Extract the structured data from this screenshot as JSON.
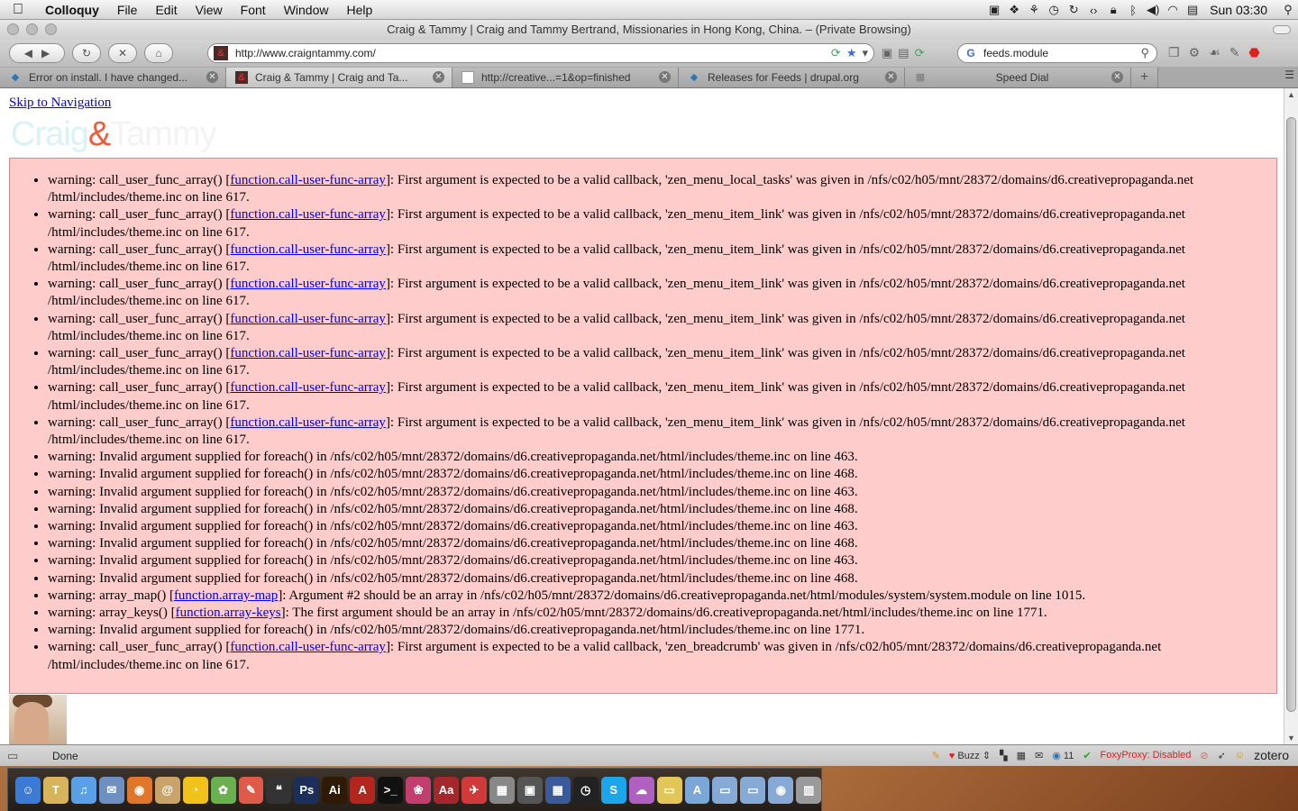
{
  "menubar": {
    "app_name": "Colloquy",
    "menus": [
      "File",
      "Edit",
      "View",
      "Font",
      "Window",
      "Help"
    ],
    "clock": "Sun 03:30",
    "status_icons": [
      "screen-icon",
      "dropbox-icon",
      "timemachine-alt-icon",
      "timemachine-icon",
      "sync-icon",
      "code-icon",
      "lock-icon",
      "bluetooth-icon",
      "volume-icon",
      "wifi-icon",
      "flag-us-icon"
    ]
  },
  "window": {
    "title": "Craig & Tammy | Craig and Tammy Bertrand, Missionaries in Hong Kong, China. – (Private Browsing)"
  },
  "navbar": {
    "url": "http://www.craigntammy.com/",
    "search_value": "feeds.module",
    "favicon_text": "&"
  },
  "tabs": [
    {
      "label": "Error on install. I have changed...",
      "icon": "drupal-icon",
      "active": false
    },
    {
      "label": "Craig & Tammy | Craig and Ta...",
      "icon": "site-favicon-icon",
      "active": true
    },
    {
      "label": "http://creative...=1&op=finished",
      "icon": "page-icon",
      "active": false
    },
    {
      "label": "Releases for Feeds | drupal.org",
      "icon": "drupal-icon",
      "active": false
    },
    {
      "label": "Speed Dial",
      "icon": "grid-icon",
      "active": false
    }
  ],
  "page": {
    "skip_link": "Skip to Navigation",
    "logo": {
      "part1": "Craig",
      "amp": "&",
      "part2": "Tammy"
    },
    "messages": [
      {
        "pre": "warning: call_user_func_array() [",
        "link": "function.call-user-func-array",
        "post": "]: First argument is expected to be a valid callback, 'zen_menu_local_tasks' was given in /nfs/c02/h05/mnt/28372/domains/d6.creativepropaganda.net /html/includes/theme.inc on line 617."
      },
      {
        "pre": "warning: call_user_func_array() [",
        "link": "function.call-user-func-array",
        "post": "]: First argument is expected to be a valid callback, 'zen_menu_item_link' was given in /nfs/c02/h05/mnt/28372/domains/d6.creativepropaganda.net /html/includes/theme.inc on line 617."
      },
      {
        "pre": "warning: call_user_func_array() [",
        "link": "function.call-user-func-array",
        "post": "]: First argument is expected to be a valid callback, 'zen_menu_item_link' was given in /nfs/c02/h05/mnt/28372/domains/d6.creativepropaganda.net /html/includes/theme.inc on line 617."
      },
      {
        "pre": "warning: call_user_func_array() [",
        "link": "function.call-user-func-array",
        "post": "]: First argument is expected to be a valid callback, 'zen_menu_item_link' was given in /nfs/c02/h05/mnt/28372/domains/d6.creativepropaganda.net /html/includes/theme.inc on line 617."
      },
      {
        "pre": "warning: call_user_func_array() [",
        "link": "function.call-user-func-array",
        "post": "]: First argument is expected to be a valid callback, 'zen_menu_item_link' was given in /nfs/c02/h05/mnt/28372/domains/d6.creativepropaganda.net /html/includes/theme.inc on line 617."
      },
      {
        "pre": "warning: call_user_func_array() [",
        "link": "function.call-user-func-array",
        "post": "]: First argument is expected to be a valid callback, 'zen_menu_item_link' was given in /nfs/c02/h05/mnt/28372/domains/d6.creativepropaganda.net /html/includes/theme.inc on line 617."
      },
      {
        "pre": "warning: call_user_func_array() [",
        "link": "function.call-user-func-array",
        "post": "]: First argument is expected to be a valid callback, 'zen_menu_item_link' was given in /nfs/c02/h05/mnt/28372/domains/d6.creativepropaganda.net /html/includes/theme.inc on line 617."
      },
      {
        "pre": "warning: call_user_func_array() [",
        "link": "function.call-user-func-array",
        "post": "]: First argument is expected to be a valid callback, 'zen_menu_item_link' was given in /nfs/c02/h05/mnt/28372/domains/d6.creativepropaganda.net /html/includes/theme.inc on line 617."
      },
      {
        "pre": "warning: Invalid argument supplied for foreach() in /nfs/c02/h05/mnt/28372/domains/d6.creativepropaganda.net/html/includes/theme.inc on line 463.",
        "link": "",
        "post": ""
      },
      {
        "pre": "warning: Invalid argument supplied for foreach() in /nfs/c02/h05/mnt/28372/domains/d6.creativepropaganda.net/html/includes/theme.inc on line 468.",
        "link": "",
        "post": ""
      },
      {
        "pre": "warning: Invalid argument supplied for foreach() in /nfs/c02/h05/mnt/28372/domains/d6.creativepropaganda.net/html/includes/theme.inc on line 463.",
        "link": "",
        "post": ""
      },
      {
        "pre": "warning: Invalid argument supplied for foreach() in /nfs/c02/h05/mnt/28372/domains/d6.creativepropaganda.net/html/includes/theme.inc on line 468.",
        "link": "",
        "post": ""
      },
      {
        "pre": "warning: Invalid argument supplied for foreach() in /nfs/c02/h05/mnt/28372/domains/d6.creativepropaganda.net/html/includes/theme.inc on line 463.",
        "link": "",
        "post": ""
      },
      {
        "pre": "warning: Invalid argument supplied for foreach() in /nfs/c02/h05/mnt/28372/domains/d6.creativepropaganda.net/html/includes/theme.inc on line 468.",
        "link": "",
        "post": ""
      },
      {
        "pre": "warning: Invalid argument supplied for foreach() in /nfs/c02/h05/mnt/28372/domains/d6.creativepropaganda.net/html/includes/theme.inc on line 463.",
        "link": "",
        "post": ""
      },
      {
        "pre": "warning: Invalid argument supplied for foreach() in /nfs/c02/h05/mnt/28372/domains/d6.creativepropaganda.net/html/includes/theme.inc on line 468.",
        "link": "",
        "post": ""
      },
      {
        "pre": "warning: array_map() [",
        "link": "function.array-map",
        "post": "]: Argument #2 should be an array in /nfs/c02/h05/mnt/28372/domains/d6.creativepropaganda.net/html/modules/system/system.module on line 1015."
      },
      {
        "pre": "warning: array_keys() [",
        "link": "function.array-keys",
        "post": "]: The first argument should be an array in /nfs/c02/h05/mnt/28372/domains/d6.creativepropaganda.net/html/includes/theme.inc on line 1771."
      },
      {
        "pre": "warning: Invalid argument supplied for foreach() in /nfs/c02/h05/mnt/28372/domains/d6.creativepropaganda.net/html/includes/theme.inc on line 1771.",
        "link": "",
        "post": ""
      },
      {
        "pre": "warning: call_user_func_array() [",
        "link": "function.call-user-func-array",
        "post": "]: First argument is expected to be a valid callback, 'zen_breadcrumb' was given in /nfs/c02/h05/mnt/28372/domains/d6.creativepropaganda.net /html/includes/theme.inc on line 617."
      }
    ]
  },
  "statusbar": {
    "status_text": "Done",
    "buzz_label": "Buzz",
    "count": "11",
    "proxy": "FoxyProxy: Disabled",
    "zotero": "zotero"
  },
  "dock": {
    "apps": [
      {
        "name": "finder-icon",
        "color": "#3b7bd6",
        "glyph": "☺"
      },
      {
        "name": "tagit-icon",
        "color": "#d7b45a",
        "glyph": "T"
      },
      {
        "name": "itunes-icon",
        "color": "#5aa0e6",
        "glyph": "♫"
      },
      {
        "name": "mail-icon",
        "color": "#6d8fc2",
        "glyph": "✉"
      },
      {
        "name": "firefox-icon",
        "color": "#e0762a",
        "glyph": "◉"
      },
      {
        "name": "addressbook-icon",
        "color": "#c9a36a",
        "glyph": "@"
      },
      {
        "name": "adium-icon",
        "color": "#f1c31a",
        "glyph": "◔"
      },
      {
        "name": "chat-icon",
        "color": "#6bb04e",
        "glyph": "✿"
      },
      {
        "name": "textedit-icon",
        "color": "#e05a4a",
        "glyph": "✎"
      },
      {
        "name": "quotes-icon",
        "color": "#333333",
        "glyph": "❝"
      },
      {
        "name": "photoshop-icon",
        "color": "#1b2f5a",
        "glyph": "Ps"
      },
      {
        "name": "illustrator-icon",
        "color": "#2e1a05",
        "glyph": "Ai"
      },
      {
        "name": "acrobat-icon",
        "color": "#b3261e",
        "glyph": "A"
      },
      {
        "name": "terminal-icon",
        "color": "#111111",
        "glyph": ">_"
      },
      {
        "name": "flower-icon",
        "color": "#c23e6e",
        "glyph": "❀"
      },
      {
        "name": "dictionary-icon",
        "color": "#a3272b",
        "glyph": "Aa"
      },
      {
        "name": "bookmark-icon",
        "color": "#d03a3a",
        "glyph": "✈"
      },
      {
        "name": "calculator-icon",
        "color": "#888888",
        "glyph": "▦"
      },
      {
        "name": "screens-icon",
        "color": "#555555",
        "glyph": "▣"
      },
      {
        "name": "spaces-icon",
        "color": "#3a5a9a",
        "glyph": "▦"
      },
      {
        "name": "dashboard-icon",
        "color": "#222222",
        "glyph": "◷"
      },
      {
        "name": "skype-icon",
        "color": "#1aa6e8",
        "glyph": "S"
      },
      {
        "name": "colloquy-icon",
        "color": "#b060c0",
        "glyph": "☁"
      },
      {
        "name": "folder-icon",
        "color": "#e3c65a",
        "glyph": "▭"
      },
      {
        "name": "apps-folder-icon",
        "color": "#7aa6d8",
        "glyph": "A"
      },
      {
        "name": "docs-folder-icon",
        "color": "#86a9d6",
        "glyph": "▭"
      },
      {
        "name": "downloads-folder-icon",
        "color": "#86a9d6",
        "glyph": "▭"
      },
      {
        "name": "stack-icon",
        "color": "#86a9d6",
        "glyph": "◉"
      },
      {
        "name": "trash-icon",
        "color": "#9a9a9a",
        "glyph": "▥"
      }
    ]
  }
}
